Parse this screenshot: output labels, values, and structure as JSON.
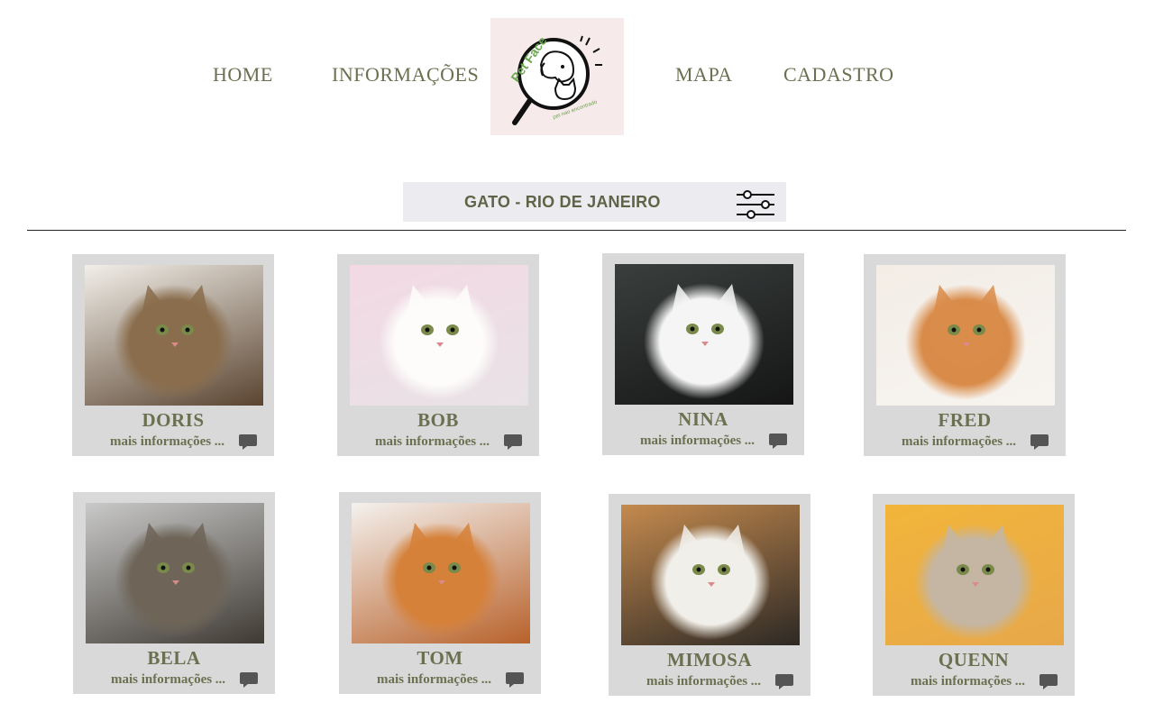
{
  "nav": {
    "home": "HOME",
    "info": "INFORMAÇÕES",
    "map": "MAPA",
    "register": "CADASTRO"
  },
  "logo": {
    "text": "Pet Face",
    "tagline": "pet nao encontrado"
  },
  "filter": {
    "label": "GATO - RIO DE JANEIRO",
    "icon": "sliders-icon"
  },
  "cards": [
    {
      "name": "DORIS",
      "more": "mais informações ..."
    },
    {
      "name": "BOB",
      "more": "mais informações ..."
    },
    {
      "name": "NINA",
      "more": "mais informações ..."
    },
    {
      "name": "FRED",
      "more": "mais informações ..."
    },
    {
      "name": "BELA",
      "more": "mais informações ..."
    },
    {
      "name": "TOM",
      "more": "mais informações ..."
    },
    {
      "name": "MIMOSA",
      "more": "mais informações ..."
    },
    {
      "name": "QUENN",
      "more": "mais informações ..."
    }
  ],
  "colors": {
    "accent": "#6b7050",
    "card_bg": "#d9d9d9",
    "filter_bg": "#ecebef",
    "logo_bg": "#f7eaea"
  }
}
